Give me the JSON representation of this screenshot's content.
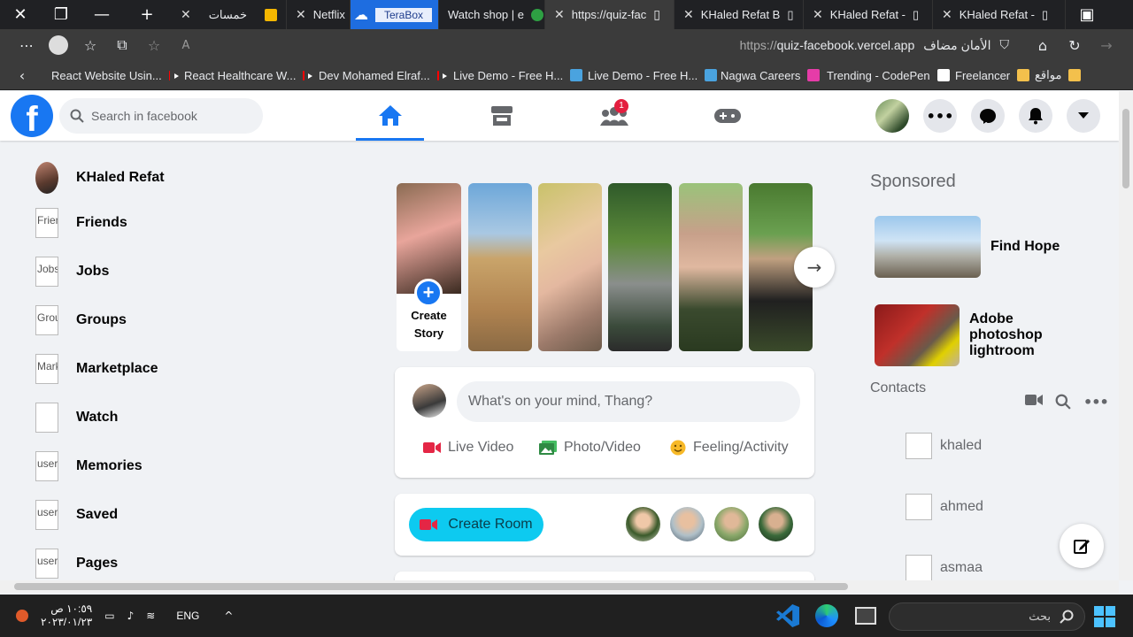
{
  "browser": {
    "tabs": [
      {
        "label": "خمسات"
      },
      {
        "label": "Netflix"
      },
      {
        "label": "TeraBox"
      },
      {
        "label": "Watch shop | e"
      },
      {
        "label": "https://quiz-fac"
      },
      {
        "label": "KHaled Refat B"
      },
      {
        "label": "KHaled Refat -"
      },
      {
        "label": "KHaled Refat -"
      }
    ],
    "url_scheme": "https://",
    "url_host": "quiz-facebook.vercel.app",
    "security_label": "الأمان مضاف",
    "bookmarks": [
      {
        "label": "React Website Usin..."
      },
      {
        "label": "React Healthcare W..."
      },
      {
        "label": "Dev Mohamed Elraf..."
      },
      {
        "label": "Live Demo - Free H..."
      },
      {
        "label": "Live Demo - Free H..."
      },
      {
        "label": "Nagwa Careers"
      },
      {
        "label": "Trending - CodePen"
      },
      {
        "label": "Freelancer"
      },
      {
        "label": "مواقع"
      }
    ]
  },
  "header": {
    "logo": "f",
    "search_placeholder": "Search in facebook",
    "friend_requests_badge": "1",
    "active_nav": "home"
  },
  "sidebar": {
    "profile_name": "KHaled Refat",
    "items": [
      {
        "label": "Friends",
        "alt": "Friends"
      },
      {
        "label": "Jobs",
        "alt": "Jobs"
      },
      {
        "label": "Groups",
        "alt": "Groups"
      },
      {
        "label": "Marketplace",
        "alt": "Marketplace"
      },
      {
        "label": "Watch",
        "alt": ""
      },
      {
        "label": "Memories",
        "alt": "user"
      },
      {
        "label": "Saved",
        "alt": "user"
      },
      {
        "label": "Pages",
        "alt": "user"
      }
    ]
  },
  "stories": {
    "create_label": "Create Story"
  },
  "composer": {
    "placeholder": "What's on your mind, Thang?",
    "actions": [
      {
        "label": "Live Video",
        "color": "#e42645"
      },
      {
        "label": "Photo/Video",
        "color": "#45bd62"
      },
      {
        "label": "Feeling/Activity",
        "color": "#f7b928"
      }
    ]
  },
  "rooms": {
    "create_room_label": "Create Room",
    "accent": "#0dcaf0"
  },
  "rightbar": {
    "sponsored_title": "Sponsored",
    "sponsored": [
      {
        "label": "Find Hope"
      },
      {
        "label": "Adobe photoshop lightroom"
      }
    ],
    "contacts_title": "Contacts",
    "contacts": [
      {
        "name": "khaled"
      },
      {
        "name": "ahmed"
      },
      {
        "name": "asmaa"
      }
    ]
  },
  "taskbar": {
    "time": "١٠:٥٩ ص",
    "date": "٢٠٢٣/٠١/٢٣",
    "language": "ENG",
    "search_label": "بحث"
  },
  "colors": {
    "brand": "#1877f2",
    "badge": "#e41e3f"
  }
}
